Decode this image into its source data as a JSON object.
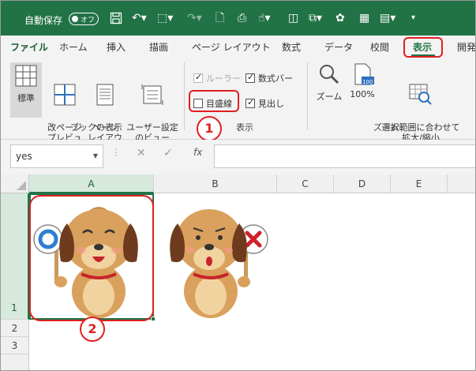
{
  "titlebar": {
    "autosave_label": "自動保存",
    "autosave_state": "オフ"
  },
  "tabs": [
    "ファイル",
    "ホーム",
    "挿入",
    "描画",
    "ページ レイアウト",
    "数式",
    "データ",
    "校閲",
    "表示",
    "開発"
  ],
  "active_tab": "表示",
  "ribbon": {
    "workbook_views": {
      "normal": "標準",
      "page_break": "改ページ\nプレビュー",
      "page_layout": "ページ\nレイアウト",
      "custom_views": "ユーザー設定\nのビュー",
      "label": "ブックの表示"
    },
    "show": {
      "ruler": "ルーラー",
      "formula_bar": "数式バー",
      "gridlines": "目盛線",
      "headings": "見出し",
      "label": "表示"
    },
    "zoom": {
      "zoom": "ズーム",
      "hundred": "100%",
      "zoom_to_selection": "選択範囲に合わせて\n拡大/縮小",
      "label": "ズーム",
      "hundred_icon_text": "100"
    }
  },
  "formula_bar": {
    "name_box": "yes",
    "cancel": "✕",
    "enter": "✓",
    "fx": "fx",
    "content": ""
  },
  "grid": {
    "columns": [
      "A",
      "B",
      "C",
      "D",
      "E"
    ],
    "rows": [
      "1",
      "2",
      "3"
    ]
  },
  "annotations": {
    "badge1": "1",
    "badge2": "2"
  },
  "colors": {
    "excel_green": "#217346",
    "annotation_red": "#e02020"
  }
}
